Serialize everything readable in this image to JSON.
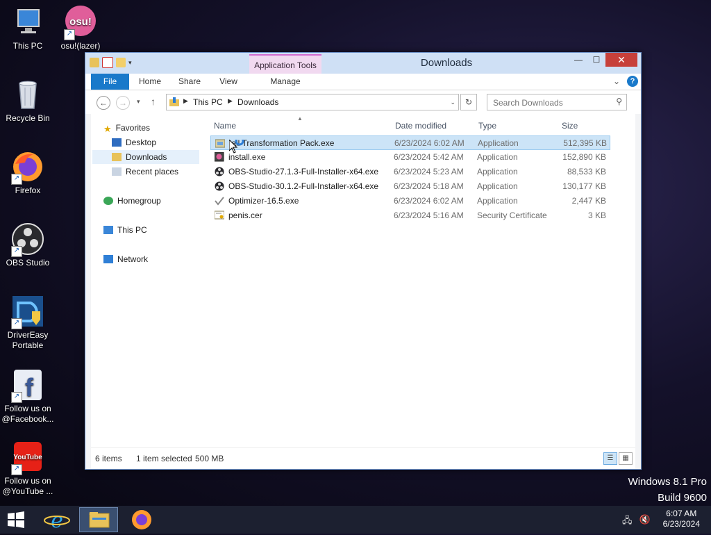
{
  "desktop": {
    "icons": [
      {
        "label": "This PC"
      },
      {
        "label": "osu!(lazer)",
        "logo": "osu!"
      },
      {
        "label": "Recycle Bin"
      },
      {
        "label": "Firefox"
      },
      {
        "label": "OBS Studio"
      },
      {
        "label": "DriverEasy Portable"
      },
      {
        "label": "Follow us on @Facebook...",
        "logo": "f"
      },
      {
        "label": "Follow us on @YouTube ...",
        "logo": "YouTube"
      }
    ],
    "watermark": {
      "line1": "Windows 8.1 Pro",
      "line2": "Build 9600"
    }
  },
  "window": {
    "title": "Downloads",
    "contextual_tab": "Application Tools",
    "ribbon_tabs": {
      "file": "File",
      "home": "Home",
      "share": "Share",
      "view": "View",
      "manage": "Manage"
    },
    "address": {
      "crumbs": [
        "This PC",
        "Downloads"
      ]
    },
    "search": {
      "placeholder": "Search Downloads"
    },
    "nav": {
      "favorites": "Favorites",
      "desktop": "Desktop",
      "downloads": "Downloads",
      "recent": "Recent places",
      "homegroup": "Homegroup",
      "thispc": "This PC",
      "network": "Network"
    },
    "columns": {
      "name": "Name",
      "date": "Date modified",
      "type": "Type",
      "size": "Size"
    },
    "files": [
      {
        "name": "Install Transformation Pack.exe",
        "visible_name": "tall Transformation Pack.exe",
        "date": "6/23/2024 6:02 AM",
        "type": "Application",
        "size": "512,395 KB",
        "icon": "installer-icon"
      },
      {
        "name": "install.exe",
        "date": "6/23/2024 5:42 AM",
        "type": "Application",
        "size": "152,890 KB",
        "icon": "app-icon"
      },
      {
        "name": "OBS-Studio-27.1.3-Full-Installer-x64.exe",
        "date": "6/23/2024 5:23 AM",
        "type": "Application",
        "size": "88,533 KB",
        "icon": "obs-icon"
      },
      {
        "name": "OBS-Studio-30.1.2-Full-Installer-x64.exe",
        "date": "6/23/2024 5:18 AM",
        "type": "Application",
        "size": "130,177 KB",
        "icon": "obs-icon"
      },
      {
        "name": "Optimizer-16.5.exe",
        "date": "6/23/2024 6:02 AM",
        "type": "Application",
        "size": "2,447 KB",
        "icon": "checkmark-icon"
      },
      {
        "name": "penis.cer",
        "date": "6/23/2024 5:16 AM",
        "type": "Security Certificate",
        "size": "3 KB",
        "icon": "certificate-icon"
      }
    ],
    "status": {
      "items": "6 items",
      "selected": "1 item selected",
      "size": "500 MB"
    }
  },
  "taskbar": {
    "time": "6:07 AM",
    "date": "6/23/2024"
  },
  "colors": {
    "accent": "#1979ca",
    "selection": "#cce4f7",
    "context_tab": "#f1d9f0",
    "close": "#c7403a",
    "taskbar": "#1c2030"
  }
}
